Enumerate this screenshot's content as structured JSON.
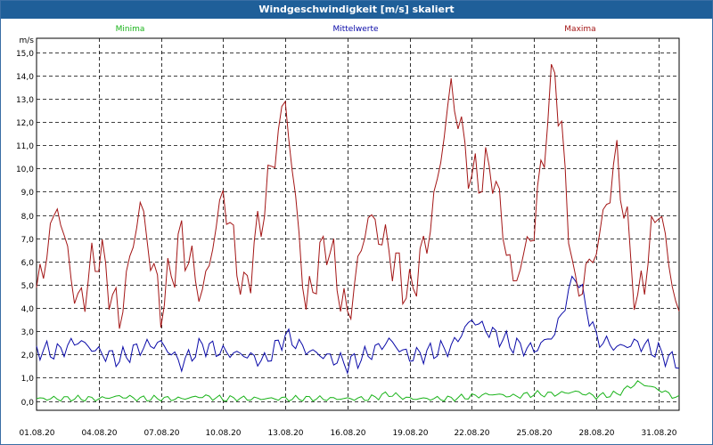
{
  "window": {
    "title": "Windgeschwindigkeit [m/s] skaliert"
  },
  "colors": {
    "minima": "#19b319",
    "mittelwerte": "#0a0aa8",
    "maxima": "#a31515",
    "grid": "#000000"
  },
  "chart_data": {
    "type": "line",
    "title": "Windgeschwindigkeit [m/s] skaliert",
    "ylabel": "m/s",
    "ylim": [
      -0.4,
      15.6
    ],
    "yticks": [
      0,
      1,
      2,
      3,
      4,
      5,
      6,
      7,
      8,
      9,
      10,
      11,
      12,
      13,
      14,
      15
    ],
    "ytick_labels": [
      "0,0",
      "1,0",
      "2,0",
      "3,0",
      "4,0",
      "5,0",
      "6,0",
      "7,0",
      "8,0",
      "9,0",
      "10,0",
      "11,0",
      "12,0",
      "13,0",
      "14,0",
      "15,0"
    ],
    "xlim": [
      "2020-08-01",
      "2020-09-01"
    ],
    "xtick_labels": [
      "01.08.20",
      "04.08.20",
      "07.08.20",
      "10.08.20",
      "13.08.20",
      "16.08.20",
      "19.08.20",
      "22.08.20",
      "25.08.20",
      "28.08.20",
      "31.08.20"
    ],
    "grid": true,
    "legend": "top",
    "x": [
      "2020-08-01",
      "2020-08-02",
      "2020-08-03",
      "2020-08-04",
      "2020-08-05",
      "2020-08-06",
      "2020-08-07",
      "2020-08-08",
      "2020-08-09",
      "2020-08-10",
      "2020-08-11",
      "2020-08-12",
      "2020-08-13",
      "2020-08-14",
      "2020-08-15",
      "2020-08-16",
      "2020-08-17",
      "2020-08-18",
      "2020-08-19",
      "2020-08-20",
      "2020-08-21",
      "2020-08-22",
      "2020-08-23",
      "2020-08-24",
      "2020-08-25",
      "2020-08-26",
      "2020-08-27",
      "2020-08-28",
      "2020-08-29",
      "2020-08-30",
      "2020-08-31",
      "2020-09-01"
    ],
    "series": [
      {
        "name": "Minima",
        "values": [
          0.1,
          0.1,
          0.1,
          0.1,
          0.2,
          0.1,
          0.1,
          0.1,
          0.2,
          0.1,
          0.1,
          0.1,
          0.1,
          0.1,
          0.1,
          0.1,
          0.1,
          0.3,
          0.1,
          0.1,
          0.1,
          0.2,
          0.3,
          0.2,
          0.3,
          0.3,
          0.4,
          0.2,
          0.3,
          0.8,
          0.5,
          0.1
        ]
      },
      {
        "name": "Mittelwerte",
        "values": [
          2.2,
          2.1,
          2.6,
          2.1,
          1.8,
          2.3,
          2.5,
          1.6,
          2.4,
          2.1,
          2.0,
          1.7,
          2.8,
          2.2,
          1.9,
          1.6,
          2.0,
          2.6,
          1.9,
          2.1,
          2.3,
          3.5,
          2.9,
          2.4,
          2.2,
          2.9,
          5.5,
          2.7,
          2.3,
          2.5,
          2.1,
          1.6
        ]
      },
      {
        "name": "Maxima",
        "values": [
          4.5,
          8.5,
          4.0,
          6.5,
          3.5,
          8.5,
          4.0,
          7.0,
          4.5,
          9.0,
          4.5,
          8.5,
          13.0,
          4.0,
          7.0,
          3.5,
          8.0,
          6.5,
          4.5,
          7.5,
          13.5,
          9.5,
          10.0,
          5.0,
          7.5,
          14.5,
          4.5,
          6.5,
          10.5,
          4.0,
          8.5,
          3.5
        ]
      }
    ]
  }
}
